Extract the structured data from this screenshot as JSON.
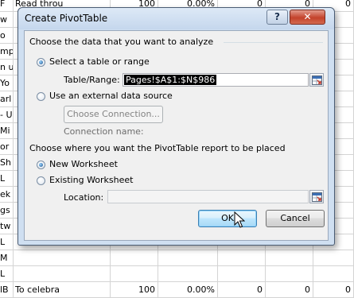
{
  "sheet": {
    "rows": [
      {
        "c0": "F",
        "c1": "Read throu",
        "c2": "100",
        "c3": "0.00%",
        "c4": "0",
        "c5": "0",
        "c6": "0"
      },
      {
        "c0": "w",
        "c1": "",
        "c2": "",
        "c3": "",
        "c4": "",
        "c5": "",
        "c6": ""
      },
      {
        "c0": "o",
        "c1": "",
        "c2": "",
        "c3": "",
        "c4": "",
        "c5": "",
        "c6": ""
      },
      {
        "c0": "mp",
        "c1": "",
        "c2": "",
        "c3": "",
        "c4": "",
        "c5": "",
        "c6": ""
      },
      {
        "c0": "n u",
        "c1": "",
        "c2": "",
        "c3": "",
        "c4": "",
        "c5": "",
        "c6": ""
      },
      {
        "c0": "Yo",
        "c1": "",
        "c2": "",
        "c3": "",
        "c4": "",
        "c5": "",
        "c6": ""
      },
      {
        "c0": "arl",
        "c1": "",
        "c2": "",
        "c3": "",
        "c4": "",
        "c5": "",
        "c6": ""
      },
      {
        "c0": "- U",
        "c1": "",
        "c2": "",
        "c3": "",
        "c4": "",
        "c5": "",
        "c6": ""
      },
      {
        "c0": "Mi",
        "c1": "",
        "c2": "",
        "c3": "",
        "c4": "",
        "c5": "",
        "c6": ""
      },
      {
        "c0": "or",
        "c1": "",
        "c2": "",
        "c3": "",
        "c4": "",
        "c5": "",
        "c6": ""
      },
      {
        "c0": "Sh",
        "c1": "",
        "c2": "",
        "c3": "",
        "c4": "",
        "c5": "",
        "c6": ""
      },
      {
        "c0": "L",
        "c1": "",
        "c2": "",
        "c3": "",
        "c4": "",
        "c5": "",
        "c6": ""
      },
      {
        "c0": "ek",
        "c1": "",
        "c2": "",
        "c3": "",
        "c4": "",
        "c5": "",
        "c6": ""
      },
      {
        "c0": "gs",
        "c1": "",
        "c2": "",
        "c3": "",
        "c4": "",
        "c5": "",
        "c6": ""
      },
      {
        "c0": "tw",
        "c1": "",
        "c2": "",
        "c3": "",
        "c4": "",
        "c5": "",
        "c6": ""
      },
      {
        "c0": "L",
        "c1": "",
        "c2": "",
        "c3": "",
        "c4": "",
        "c5": "",
        "c6": ""
      },
      {
        "c0": "M",
        "c1": "",
        "c2": "",
        "c3": "",
        "c4": "",
        "c5": "",
        "c6": ""
      },
      {
        "c0": "L",
        "c1": "",
        "c2": "",
        "c3": "",
        "c4": "",
        "c5": "",
        "c6": ""
      },
      {
        "c0": "lB",
        "c1": "To celebra",
        "c2": "100",
        "c3": "0.00%",
        "c4": "0",
        "c5": "0",
        "c6": "0"
      }
    ]
  },
  "dialog": {
    "title": "Create PivotTable",
    "help_label": "?",
    "close_label": "✕",
    "section1_label": "Choose the data that you want to analyze",
    "option_table_range": "Select a table or range",
    "table_range_label": "Table/Range:",
    "table_range_value": "Pages!$A$1:$N$986",
    "option_external": "Use an external data source",
    "choose_connection_label": "Choose Connection...",
    "connection_name_label": "Connection name:",
    "section2_label": "Choose where you want the PivotTable report to be placed",
    "option_new_worksheet": "New Worksheet",
    "option_existing_worksheet": "Existing Worksheet",
    "location_label": "Location:",
    "location_value": "",
    "ok_label": "OK",
    "cancel_label": "Cancel"
  },
  "colors": {
    "frame": "#cfdff1",
    "client": "#f0f0f0",
    "close_button": "#c3422b",
    "default_button": "#bee6fd"
  }
}
